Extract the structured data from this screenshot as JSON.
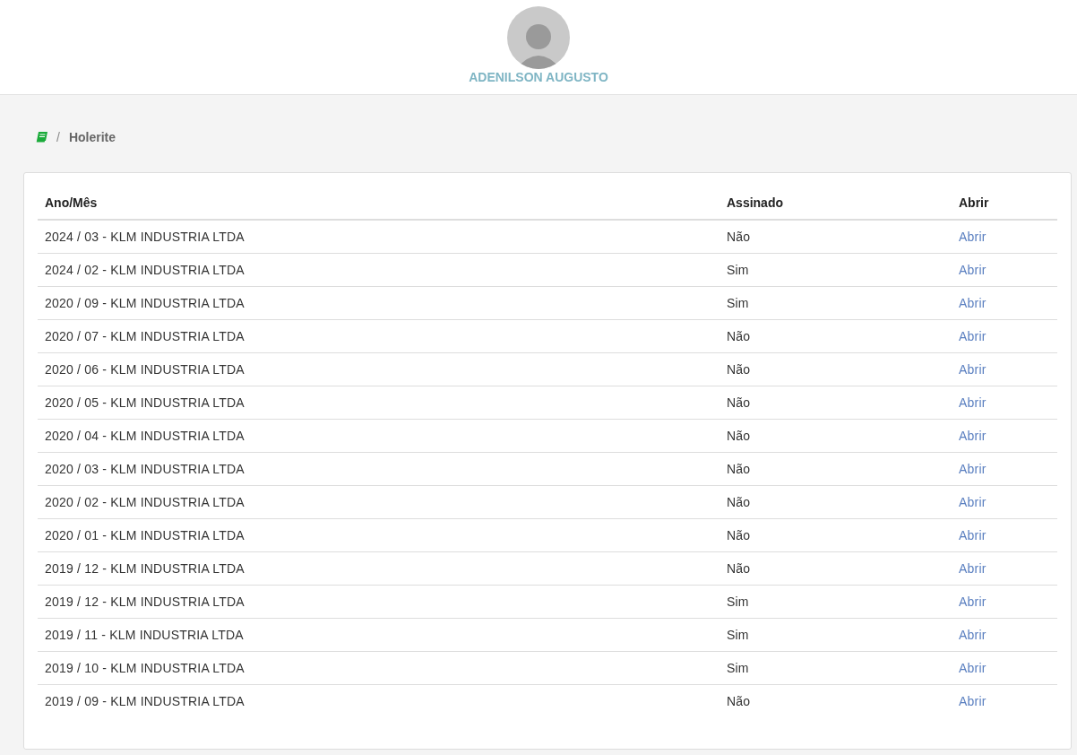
{
  "header": {
    "user_name": "ADENILSON AUGUSTO"
  },
  "breadcrumb": {
    "separator": "/",
    "current": "Holerite"
  },
  "table": {
    "columns": [
      "Ano/Mês",
      "Assinado",
      "Abrir"
    ],
    "rows": [
      {
        "period": "2024 / 03 - KLM INDUSTRIA LTDA",
        "signed": "Não",
        "open": "Abrir"
      },
      {
        "period": "2024 / 02 - KLM INDUSTRIA LTDA",
        "signed": "Sim",
        "open": "Abrir"
      },
      {
        "period": "2020 / 09 - KLM INDUSTRIA LTDA",
        "signed": "Sim",
        "open": "Abrir"
      },
      {
        "period": "2020 / 07 - KLM INDUSTRIA LTDA",
        "signed": "Não",
        "open": "Abrir"
      },
      {
        "period": "2020 / 06 - KLM INDUSTRIA LTDA",
        "signed": "Não",
        "open": "Abrir"
      },
      {
        "period": "2020 / 05 - KLM INDUSTRIA LTDA",
        "signed": "Não",
        "open": "Abrir"
      },
      {
        "period": "2020 / 04 - KLM INDUSTRIA LTDA",
        "signed": "Não",
        "open": "Abrir"
      },
      {
        "period": "2020 / 03 - KLM INDUSTRIA LTDA",
        "signed": "Não",
        "open": "Abrir"
      },
      {
        "period": "2020 / 02 - KLM INDUSTRIA LTDA",
        "signed": "Não",
        "open": "Abrir"
      },
      {
        "period": "2020 / 01 - KLM INDUSTRIA LTDA",
        "signed": "Não",
        "open": "Abrir"
      },
      {
        "period": "2019 / 12 - KLM INDUSTRIA LTDA",
        "signed": "Não",
        "open": "Abrir"
      },
      {
        "period": "2019 / 12 - KLM INDUSTRIA LTDA",
        "signed": "Sim",
        "open": "Abrir"
      },
      {
        "period": "2019 / 11 - KLM INDUSTRIA LTDA",
        "signed": "Sim",
        "open": "Abrir"
      },
      {
        "period": "2019 / 10 - KLM INDUSTRIA LTDA",
        "signed": "Sim",
        "open": "Abrir"
      },
      {
        "period": "2019 / 09 - KLM INDUSTRIA LTDA",
        "signed": "Não",
        "open": "Abrir"
      }
    ]
  }
}
